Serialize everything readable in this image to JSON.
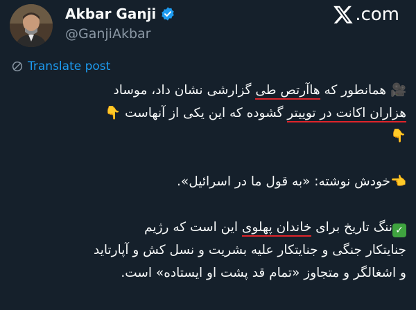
{
  "author": {
    "display_name": "Akbar Ganji",
    "handle": "@GanjiAkbar"
  },
  "brand": {
    "text": ".com"
  },
  "translate": {
    "label": "Translate post"
  },
  "post": {
    "line1_prefix": "همانطور که ",
    "line1_hl": "هاآرتص طی",
    "line1_suffix": " گزارشی نشان داد، موساد",
    "line2_hl": "هزاران اکانت در توییتر",
    "line2_suffix": " گشوده که این یکی از آنهاست",
    "line3_pointer": "👇",
    "line4": "خودش نوشته: «به قول ما در اسرائیل».",
    "line5_prefix": "ننگ تاریخ برای ",
    "line5_hl": "خاندان پهلوی",
    "line5_suffix": " این است که رژیم",
    "line6": "جنایتکار جنگی و جنایتکار علیه بشریت و نسل کش و آپارتاید",
    "line7": "و اشغالگر و متجاوز «تمام قد پشت او ایستاده» است.",
    "emoji_camera": "🎥",
    "emoji_point_down": "👇",
    "emoji_point_left": "👈",
    "emoji_check": "✓"
  },
  "colors": {
    "background": "#15202b",
    "link": "#1d9bf0",
    "verified": "#1d9bf0",
    "highlight_underline": "#e0242a"
  }
}
